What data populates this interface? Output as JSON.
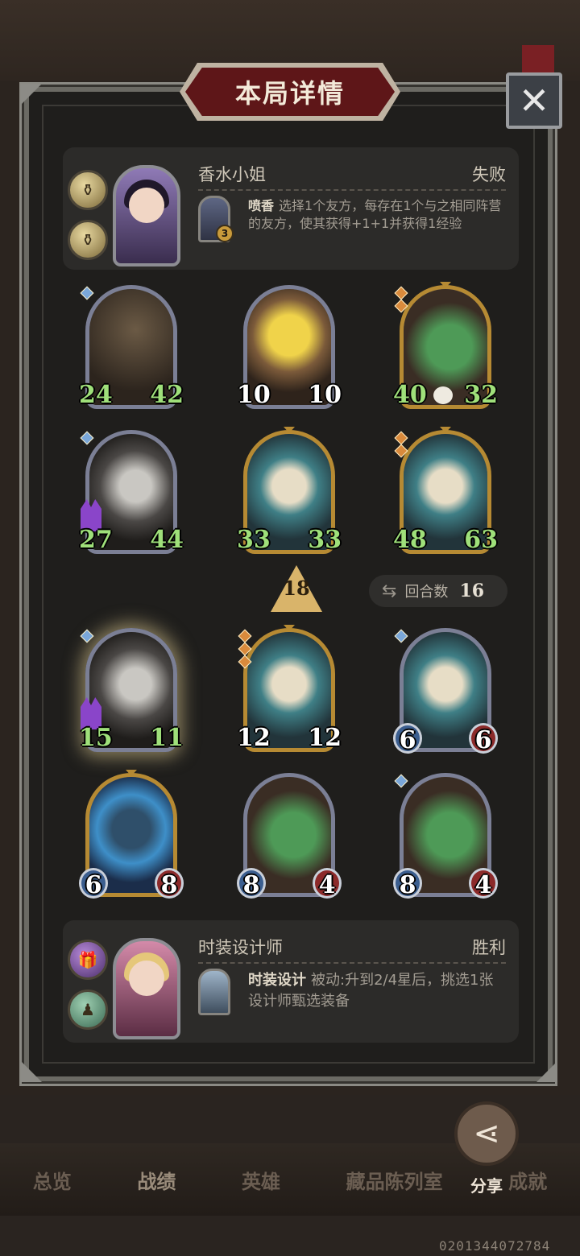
{
  "dialog": {
    "title": "本局详情",
    "close_symbol": "✕"
  },
  "top_player": {
    "name": "香水小姐",
    "result": "失败",
    "skill_name": "喷香",
    "skill_desc": "选择1个友方，每存在1个与之相同阵营的友方，使其获得+1+1并获得1经验",
    "skill_badge": "3"
  },
  "bottom_player": {
    "name": "时装设计师",
    "result": "胜利",
    "skill_name": "时装设计",
    "skill_desc": "被动:升到2/4星后，挑选1张设计师甄选装备"
  },
  "top_board": [
    {
      "atk": "24",
      "hp": "42",
      "art": "dragon-black"
    },
    {
      "atk": "10",
      "hp": "10",
      "art": "warrior"
    },
    {
      "atk": "40",
      "hp": "32",
      "art": "croc"
    },
    {
      "atk": "27",
      "hp": "44",
      "art": "grey-dragon"
    },
    {
      "atk": "33",
      "hp": "33",
      "art": "dragon-white"
    },
    {
      "atk": "48",
      "hp": "63",
      "art": "dragon-white"
    }
  ],
  "bottom_board": [
    {
      "atk": "15",
      "hp": "11",
      "art": "grey-dragon"
    },
    {
      "atk": "12",
      "hp": "12",
      "art": "dragon-white"
    },
    {
      "atk": "6",
      "hp": "6",
      "art": "dragon-white"
    },
    {
      "atk": "6",
      "hp": "8",
      "art": "blue-dragon"
    },
    {
      "atk": "8",
      "hp": "4",
      "art": "croc"
    },
    {
      "atk": "8",
      "hp": "4",
      "art": "croc"
    }
  ],
  "rank": "18",
  "round": {
    "label": "回合数",
    "value": "16"
  },
  "share": {
    "label": "分享"
  },
  "tabs": [
    "总览",
    "战绩",
    "英雄",
    "藏品陈列室",
    "成就"
  ],
  "footer_id": "0201344072784"
}
